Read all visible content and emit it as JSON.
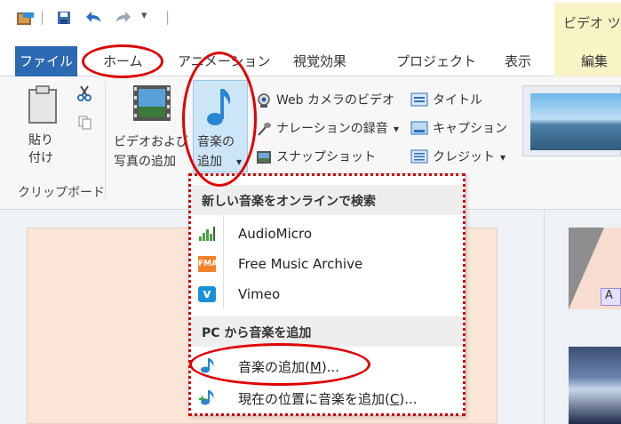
{
  "title_bar": {
    "qat_separator": "|",
    "qat_dropdown": "▾",
    "contextual_tab_header": "ビデオ ツール"
  },
  "tabs": {
    "file": "ファイル",
    "home": "ホーム",
    "animation": "アニメーション",
    "visual_effects": "視覚効果",
    "project": "プロジェクト",
    "view": "表示",
    "edit": "編集"
  },
  "ribbon": {
    "paste_line1": "貼り",
    "paste_line2": "付け",
    "clipboard_group": "クリップボード",
    "add_videos_line1": "ビデオおよび",
    "add_videos_line2": "写真の追加",
    "add_music_line1": "音楽の",
    "add_music_line2": "追加",
    "add_music_arrow": "▾",
    "webcam_video": "Web カメラのビデオ",
    "record_narration": "ナレーションの録音",
    "record_narration_arrow": "▾",
    "snapshot": "スナップショット",
    "title": "タイトル",
    "caption": "キャプション",
    "credits": "クレジット",
    "credits_arrow": "▾"
  },
  "dropdown": {
    "online_header": "新しい音楽をオンラインで検索",
    "audiomicro": "AudioMicro",
    "fma": "Free Music Archive",
    "vimeo": "Vimeo",
    "pc_header": "PC から音楽を追加",
    "add_music_prefix": "音楽の追加(",
    "add_music_key": "M",
    "add_music_suffix": ")...",
    "add_music_here_prefix": "現在の位置に音楽を追加(",
    "add_music_here_key": "C",
    "add_music_here_suffix": ")...",
    "fma_icon_text": "FMA",
    "vimeo_icon_text": "v"
  },
  "storyboard": {
    "caption_tag": "A"
  },
  "colors": {
    "file_tab": "#2b69b3",
    "annotation_red": "#e00000",
    "contextual_tab": "#f9f4c5",
    "preview_bg": "#fae5d7"
  }
}
